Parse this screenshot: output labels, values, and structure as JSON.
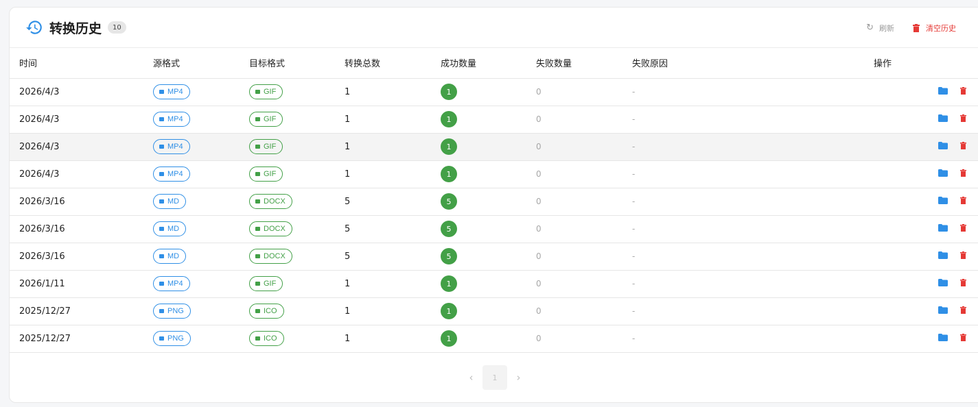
{
  "header": {
    "title": "转换历史",
    "count": "10",
    "refresh_label": "刷新",
    "clear_label": "清空历史"
  },
  "columns": {
    "time": "时间",
    "source": "源格式",
    "target": "目标格式",
    "total": "转换总数",
    "success": "成功数量",
    "fail": "失败数量",
    "reason": "失败原因",
    "actions": "操作"
  },
  "rows": [
    {
      "time": "2026/4/3",
      "source": "MP4",
      "target": "GIF",
      "total": "1",
      "success": "1",
      "fail": "0",
      "reason": "-"
    },
    {
      "time": "2026/4/3",
      "source": "MP4",
      "target": "GIF",
      "total": "1",
      "success": "1",
      "fail": "0",
      "reason": "-"
    },
    {
      "time": "2026/4/3",
      "source": "MP4",
      "target": "GIF",
      "total": "1",
      "success": "1",
      "fail": "0",
      "reason": "-"
    },
    {
      "time": "2026/4/3",
      "source": "MP4",
      "target": "GIF",
      "total": "1",
      "success": "1",
      "fail": "0",
      "reason": "-"
    },
    {
      "time": "2026/3/16",
      "source": "MD",
      "target": "DOCX",
      "total": "5",
      "success": "5",
      "fail": "0",
      "reason": "-"
    },
    {
      "time": "2026/3/16",
      "source": "MD",
      "target": "DOCX",
      "total": "5",
      "success": "5",
      "fail": "0",
      "reason": "-"
    },
    {
      "time": "2026/3/16",
      "source": "MD",
      "target": "DOCX",
      "total": "5",
      "success": "5",
      "fail": "0",
      "reason": "-"
    },
    {
      "time": "2026/1/11",
      "source": "MP4",
      "target": "GIF",
      "total": "1",
      "success": "1",
      "fail": "0",
      "reason": "-"
    },
    {
      "time": "2025/12/27",
      "source": "PNG",
      "target": "ICO",
      "total": "1",
      "success": "1",
      "fail": "0",
      "reason": "-"
    },
    {
      "time": "2025/12/27",
      "source": "PNG",
      "target": "ICO",
      "total": "1",
      "success": "1",
      "fail": "0",
      "reason": "-"
    }
  ],
  "pagination": {
    "current_page": "1",
    "prev_icon": "chevron-left-icon",
    "next_icon": "chevron-right-icon"
  },
  "colors": {
    "accent_blue": "#2f8fe6",
    "success_green": "#43a047",
    "danger_red": "#e53935"
  }
}
